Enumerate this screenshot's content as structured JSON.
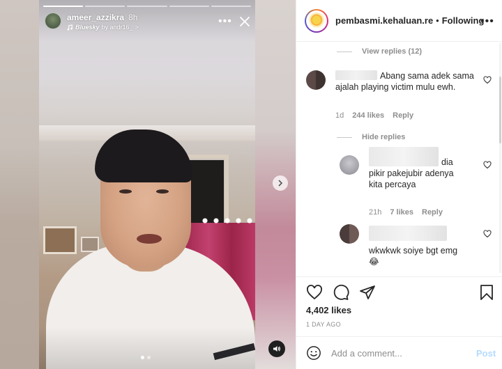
{
  "story": {
    "username": "ameer_azzikra",
    "time": "8h",
    "song": "Bluesky",
    "song_by": "by andr16_",
    "chevron": ">",
    "more": "•••",
    "progress_segments": 5,
    "progress_filled_fraction": 0.2
  },
  "post_header": {
    "username": "pembasmi.kehaluan.re",
    "dot": "•",
    "follow_label": "Following",
    "more": "•••"
  },
  "comments": {
    "view_replies": "View replies (12)",
    "hide_replies": "Hide replies",
    "items": [
      {
        "text": "Abang sama adek sama ajalah playing victim mulu ewh.",
        "age": "1d",
        "likes": "244 likes",
        "reply": "Reply"
      },
      {
        "text": "dia pikir pakejubir adenya kita percaya",
        "age": "21h",
        "likes": "7 likes",
        "reply": "Reply"
      },
      {
        "text": "wkwkwk soiye bgt emg",
        "emoji": "😂"
      }
    ]
  },
  "actions": {
    "likes": "4,402 likes",
    "ago": "1 DAY AGO"
  },
  "add_comment": {
    "placeholder": "Add a comment...",
    "post": "Post"
  },
  "colors": {
    "link_blue_disabled": "#b3dbff",
    "muted": "#8e8e8e",
    "text": "#262626",
    "curtain": "#b43763"
  }
}
